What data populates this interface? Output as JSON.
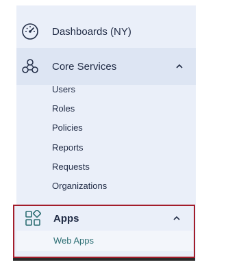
{
  "sidebar": {
    "dashboards": {
      "label": "Dashboards (NY)",
      "icon": "gauge-icon"
    },
    "core_services": {
      "label": "Core Services",
      "icon": "nodes-icon",
      "expanded": true,
      "items": [
        {
          "label": "Users"
        },
        {
          "label": "Roles"
        },
        {
          "label": "Policies"
        },
        {
          "label": "Reports"
        },
        {
          "label": "Requests"
        },
        {
          "label": "Organizations"
        }
      ]
    },
    "apps": {
      "label": "Apps",
      "icon": "apps-icon",
      "expanded": true,
      "items": [
        {
          "label": "Web Apps"
        }
      ]
    }
  },
  "colors": {
    "sidebar_bg": "#eaeff9",
    "active_row_bg": "#dde5f3",
    "highlight_border": "#a31d2b",
    "link_teal": "#2c6e73",
    "text_dark": "#1f2a44"
  }
}
